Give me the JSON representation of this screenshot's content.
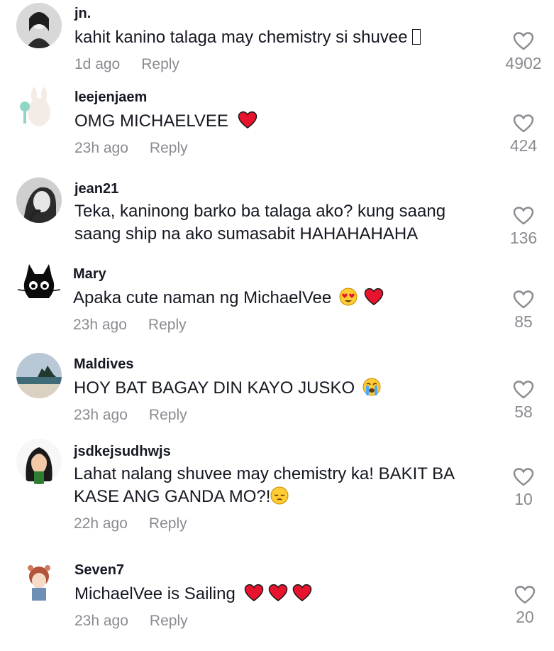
{
  "comments": [
    {
      "username": "jn.",
      "text": "kahit kanino talaga may chemistry si shuvee",
      "time": "1d ago",
      "reply": "Reply",
      "likes": "4902",
      "emoji": [
        "missing-glyph"
      ]
    },
    {
      "username": "leejenjaem",
      "text": "OMG MICHAELVEE",
      "time": "23h ago",
      "reply": "Reply",
      "likes": "424",
      "emoji": [
        "red-heart"
      ]
    },
    {
      "username": "jean21",
      "text_line1": "Teka, kaninong barko ba talaga ako? kung saang",
      "text_line2": "saang ship na ako sumasabit HAHAHAHAHA",
      "likes": "136"
    },
    {
      "username": "Mary",
      "text": "Apaka cute naman ng MichaelVee",
      "time": "23h ago",
      "reply": "Reply",
      "likes": "85",
      "emoji": [
        "heart-eyes-face",
        "red-heart"
      ]
    },
    {
      "username": "Maldives",
      "text": "HOY BAT BAGAY DIN KAYO JUSKO",
      "time": "23h ago",
      "reply": "Reply",
      "likes": "58",
      "emoji": [
        "crying-face"
      ]
    },
    {
      "username": "jsdkejsudhwjs",
      "text_line1": "Lahat nalang shuvee may chemistry ka! BAKIT BA",
      "text_line2": "KASE ANG GANDA MO?!",
      "time": "22h ago",
      "reply": "Reply",
      "likes": "10",
      "emoji": [
        "pensive-face"
      ]
    },
    {
      "username": "Seven7",
      "text": "MichaelVee is Sailing",
      "time": "23h ago",
      "reply": "Reply",
      "likes": "20",
      "emoji": [
        "red-heart",
        "red-heart",
        "red-heart"
      ]
    }
  ],
  "colors": {
    "text": "#161823",
    "muted": "#8a8b91",
    "heart": "#e8132c"
  }
}
